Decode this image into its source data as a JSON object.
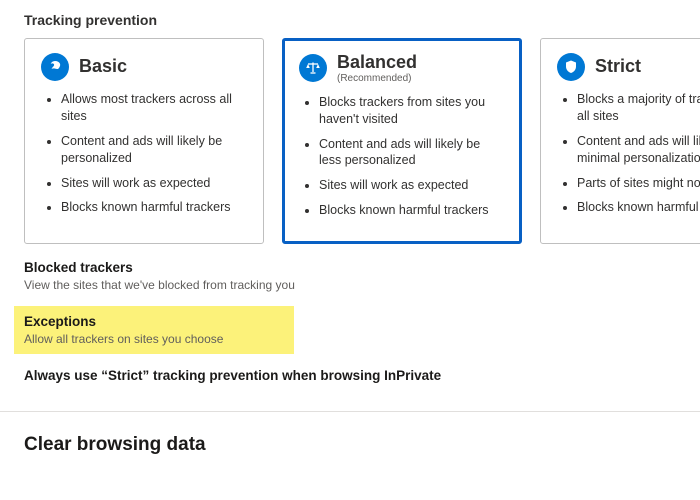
{
  "trackingPrevention": {
    "title": "Tracking prevention",
    "options": [
      {
        "name": "Basic",
        "sub": "",
        "bullets": [
          "Allows most trackers across all sites",
          "Content and ads will likely be personalized",
          "Sites will work as expected",
          "Blocks known harmful trackers"
        ],
        "selected": false
      },
      {
        "name": "Balanced",
        "sub": "(Recommended)",
        "bullets": [
          "Blocks trackers from sites you haven't visited",
          "Content and ads will likely be less personalized",
          "Sites will work as expected",
          "Blocks known harmful trackers"
        ],
        "selected": true
      },
      {
        "name": "Strict",
        "sub": "",
        "bullets": [
          "Blocks a majority of trackers from all sites",
          "Content and ads will likely have minimal personalization",
          "Parts of sites might not work",
          "Blocks known harmful trackers"
        ],
        "selected": false
      }
    ]
  },
  "links": {
    "blocked": {
      "title": "Blocked trackers",
      "sub": "View the sites that we've blocked from tracking you"
    },
    "exceptions": {
      "title": "Exceptions",
      "sub": "Allow all trackers on sites you choose"
    },
    "strictInPrivate": "Always use “Strict” tracking prevention when browsing InPrivate"
  },
  "clearData": {
    "heading": "Clear browsing data"
  }
}
